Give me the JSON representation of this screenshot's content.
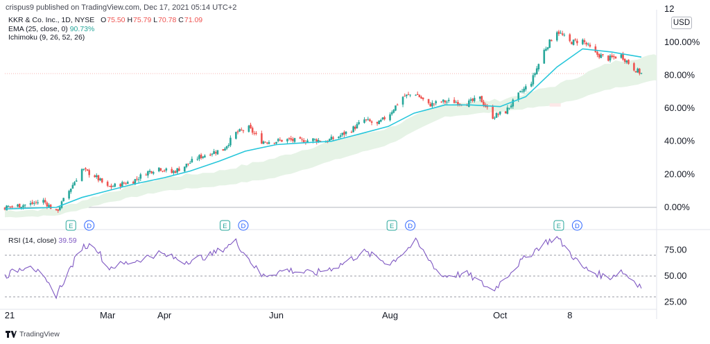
{
  "publisher": {
    "text": "crispus9 published on TradingView.com, Dec 17, 2021 05:14 UTC+2"
  },
  "legend": {
    "symbol": "KKR & Co. Inc., 1D, NYSE",
    "o_label": "O",
    "o_value": "75.50",
    "h_label": "H",
    "h_value": "75.79",
    "l_label": "L",
    "l_value": "70.78",
    "c_label": "C",
    "c_value": "71.09",
    "ema_label": "EMA (25, close, 0)",
    "ema_value": "90.73%",
    "ichimoku_label": "Ichimoku (9, 26, 52, 26)"
  },
  "rsi_legend": {
    "label": "RSI (14, close)",
    "value": "39.59"
  },
  "currency": "USD",
  "footer": {
    "brand": "TradingView"
  },
  "colors": {
    "up": "#26a69a",
    "down": "#ef5350",
    "ema": "#26c6da",
    "cloud_bull": "#e6f3e6",
    "cloud_bear": "#fde8e8",
    "rsi": "#7e57c2",
    "grid": "#787b86",
    "event": "#2962ff"
  },
  "events": {
    "earnings_label": "E",
    "dividend_label": "D",
    "earnings_dates": [
      "2021-02-09",
      "2021-05-04",
      "2021-08-03",
      "2021-11-02"
    ],
    "dividend_dates": [
      "2021-02-19",
      "2021-05-14",
      "2021-08-13",
      "2021-11-12"
    ]
  },
  "chart_data": [
    {
      "type": "candlestick",
      "title": "KKR & Co. Inc., 1D, NYSE",
      "y_unit": "percent change",
      "y_ticks": [
        "0.00%",
        "20.00%",
        "40.00%",
        "60.00%",
        "80.00%",
        "100.00%",
        "12"
      ],
      "ylim": [
        -8,
        118
      ],
      "x_ticks": [
        "21",
        "Mar",
        "Apr",
        "Jun",
        "Aug",
        "Oct",
        "8"
      ],
      "x_ticks_dates": [
        "2021-01-04",
        "2021-03-01",
        "2021-04-01",
        "2021-06-01",
        "2021-08-02",
        "2021-10-01",
        "2021-11-08"
      ],
      "xlim_dates": [
        "2021-01-04",
        "2021-12-17"
      ],
      "last_close_pct": 81,
      "price_series": [
        [
          "2021-01-04",
          0
        ],
        [
          "2021-01-11",
          1
        ],
        [
          "2021-01-18",
          2
        ],
        [
          "2021-01-25",
          4
        ],
        [
          "2021-02-01",
          -3
        ],
        [
          "2021-02-08",
          10
        ],
        [
          "2021-02-15",
          23
        ],
        [
          "2021-02-22",
          19
        ],
        [
          "2021-03-01",
          12
        ],
        [
          "2021-03-08",
          14
        ],
        [
          "2021-03-15",
          16
        ],
        [
          "2021-03-22",
          21
        ],
        [
          "2021-03-29",
          24
        ],
        [
          "2021-04-05",
          21
        ],
        [
          "2021-04-12",
          25
        ],
        [
          "2021-04-19",
          30
        ],
        [
          "2021-04-26",
          33
        ],
        [
          "2021-05-03",
          35
        ],
        [
          "2021-05-10",
          45
        ],
        [
          "2021-05-17",
          48
        ],
        [
          "2021-05-24",
          40
        ],
        [
          "2021-05-31",
          40
        ],
        [
          "2021-06-07",
          41
        ],
        [
          "2021-06-14",
          40
        ],
        [
          "2021-06-21",
          41
        ],
        [
          "2021-06-28",
          40
        ],
        [
          "2021-07-05",
          43
        ],
        [
          "2021-07-12",
          47
        ],
        [
          "2021-07-19",
          53
        ],
        [
          "2021-07-26",
          50
        ],
        [
          "2021-08-02",
          57
        ],
        [
          "2021-08-09",
          67
        ],
        [
          "2021-08-16",
          69
        ],
        [
          "2021-08-23",
          62
        ],
        [
          "2021-08-30",
          64
        ],
        [
          "2021-09-06",
          64
        ],
        [
          "2021-09-13",
          63
        ],
        [
          "2021-09-20",
          66
        ],
        [
          "2021-09-27",
          55
        ],
        [
          "2021-10-04",
          58
        ],
        [
          "2021-10-11",
          68
        ],
        [
          "2021-10-18",
          76
        ],
        [
          "2021-10-25",
          95
        ],
        [
          "2021-11-01",
          107
        ],
        [
          "2021-11-08",
          100
        ],
        [
          "2021-11-15",
          101
        ],
        [
          "2021-11-22",
          93
        ],
        [
          "2021-11-29",
          90
        ],
        [
          "2021-12-06",
          92
        ],
        [
          "2021-12-13",
          84
        ],
        [
          "2021-12-17",
          81
        ]
      ],
      "ema_series": [
        [
          "2021-01-04",
          -1
        ],
        [
          "2021-02-01",
          0
        ],
        [
          "2021-02-15",
          6
        ],
        [
          "2021-03-01",
          10
        ],
        [
          "2021-03-15",
          14
        ],
        [
          "2021-04-01",
          18
        ],
        [
          "2021-04-15",
          22
        ],
        [
          "2021-05-01",
          28
        ],
        [
          "2021-05-15",
          34
        ],
        [
          "2021-06-01",
          38
        ],
        [
          "2021-06-15",
          39
        ],
        [
          "2021-07-01",
          40
        ],
        [
          "2021-07-15",
          44
        ],
        [
          "2021-08-01",
          49
        ],
        [
          "2021-08-15",
          57
        ],
        [
          "2021-09-01",
          62
        ],
        [
          "2021-09-15",
          62
        ],
        [
          "2021-10-01",
          61
        ],
        [
          "2021-10-15",
          67
        ],
        [
          "2021-11-01",
          85
        ],
        [
          "2021-11-15",
          96
        ],
        [
          "2021-12-01",
          94
        ],
        [
          "2021-12-17",
          91
        ]
      ],
      "cloud_series": [
        [
          "2021-01-04",
          -6,
          -2
        ],
        [
          "2021-02-01",
          -5,
          -1
        ],
        [
          "2021-03-01",
          3,
          9
        ],
        [
          "2021-04-01",
          10,
          18
        ],
        [
          "2021-05-01",
          13,
          22
        ],
        [
          "2021-06-01",
          18,
          30
        ],
        [
          "2021-07-01",
          28,
          40
        ],
        [
          "2021-08-01",
          38,
          48
        ],
        [
          "2021-09-01",
          55,
          63
        ],
        [
          "2021-10-01",
          58,
          65
        ],
        [
          "2021-11-01",
          62,
          74
        ],
        [
          "2021-12-01",
          72,
          88
        ],
        [
          "2022-01-10",
          80,
          95
        ]
      ]
    },
    {
      "type": "line",
      "title": "RSI (14, close)",
      "y_ticks": [
        "25.00",
        "50.00",
        "75.00"
      ],
      "ylim": [
        22,
        90
      ],
      "bands": [
        30,
        50,
        70
      ],
      "last_value": 39.59,
      "rsi_series": [
        [
          "2021-01-04",
          50
        ],
        [
          "2021-01-18",
          62
        ],
        [
          "2021-02-01",
          32
        ],
        [
          "2021-02-15",
          78
        ],
        [
          "2021-02-22",
          80
        ],
        [
          "2021-03-01",
          58
        ],
        [
          "2021-03-15",
          64
        ],
        [
          "2021-03-29",
          72
        ],
        [
          "2021-04-12",
          64
        ],
        [
          "2021-04-26",
          70
        ],
        [
          "2021-05-10",
          83
        ],
        [
          "2021-05-24",
          50
        ],
        [
          "2021-06-07",
          56
        ],
        [
          "2021-06-21",
          52
        ],
        [
          "2021-07-05",
          60
        ],
        [
          "2021-07-19",
          73
        ],
        [
          "2021-08-02",
          62
        ],
        [
          "2021-08-16",
          83
        ],
        [
          "2021-08-30",
          50
        ],
        [
          "2021-09-13",
          52
        ],
        [
          "2021-09-27",
          36
        ],
        [
          "2021-10-11",
          62
        ],
        [
          "2021-10-25",
          82
        ],
        [
          "2021-11-01",
          87
        ],
        [
          "2021-11-15",
          58
        ],
        [
          "2021-11-29",
          48
        ],
        [
          "2021-12-06",
          55
        ],
        [
          "2021-12-17",
          40
        ]
      ]
    }
  ]
}
